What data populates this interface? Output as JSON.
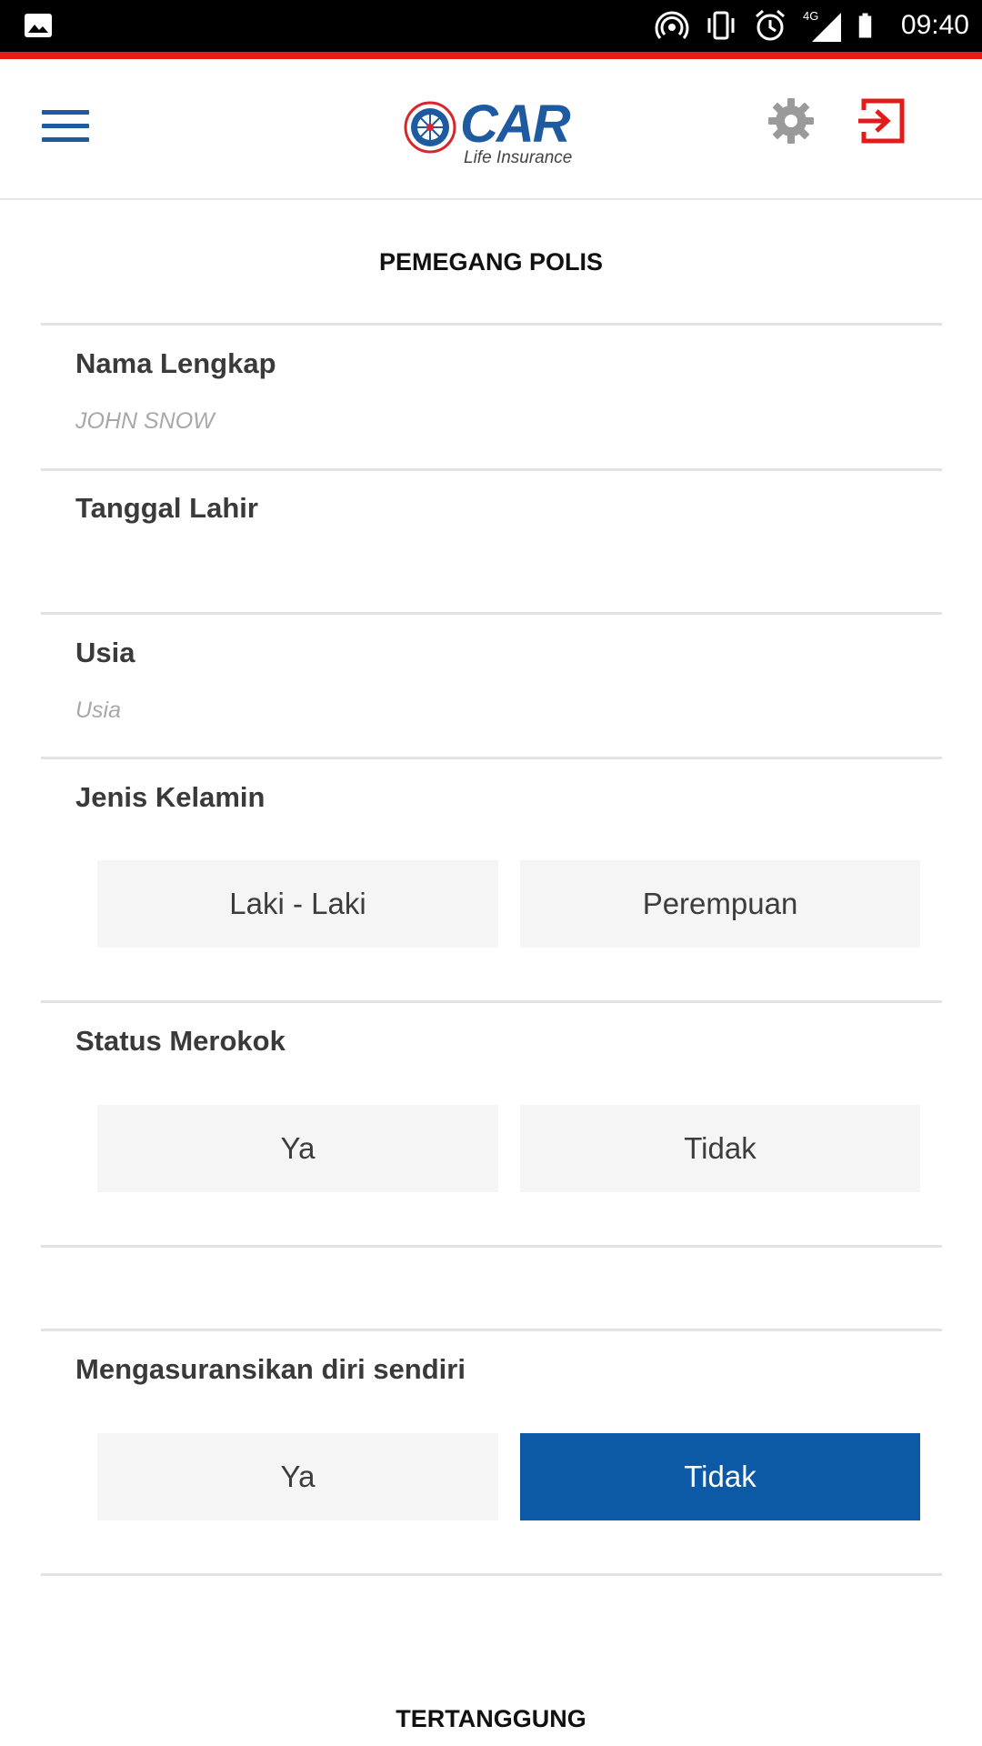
{
  "status_bar": {
    "time": "09:40",
    "network": "4G",
    "icons": [
      "image-icon",
      "hotspot-icon",
      "vibrate-icon",
      "alarm-icon",
      "signal-icon",
      "battery-icon"
    ]
  },
  "header": {
    "logo_text": "CAR",
    "logo_subtitle": "Life Insurance",
    "menu_icon": "hamburger-icon",
    "settings_icon": "gear-icon",
    "logout_icon": "logout-icon"
  },
  "colors": {
    "brand_blue": "#1e5aa0",
    "selected_blue": "#0c5aa6",
    "accent_red": "#e31b1b",
    "settings_gray": "#9a9a9a"
  },
  "section_policy_holder": {
    "title": "PEMEGANG POLIS",
    "full_name": {
      "label": "Nama Lengkap",
      "value": "",
      "placeholder": "JOHN SNOW"
    },
    "birth_date": {
      "label": "Tanggal Lahir",
      "value": "",
      "placeholder": ""
    },
    "age": {
      "label": "Usia",
      "value": "",
      "placeholder": "Usia"
    },
    "gender": {
      "label": "Jenis Kelamin",
      "options": [
        "Laki - Laki",
        "Perempuan"
      ],
      "selected": null
    },
    "smoking": {
      "label": "Status Merokok",
      "options": [
        "Ya",
        "Tidak"
      ],
      "selected": null
    },
    "insure_self": {
      "label": "Mengasuransikan diri sendiri",
      "options": [
        "Ya",
        "Tidak"
      ],
      "selected": "Tidak"
    }
  },
  "section_insured": {
    "title": "TERTANGGUNG"
  }
}
